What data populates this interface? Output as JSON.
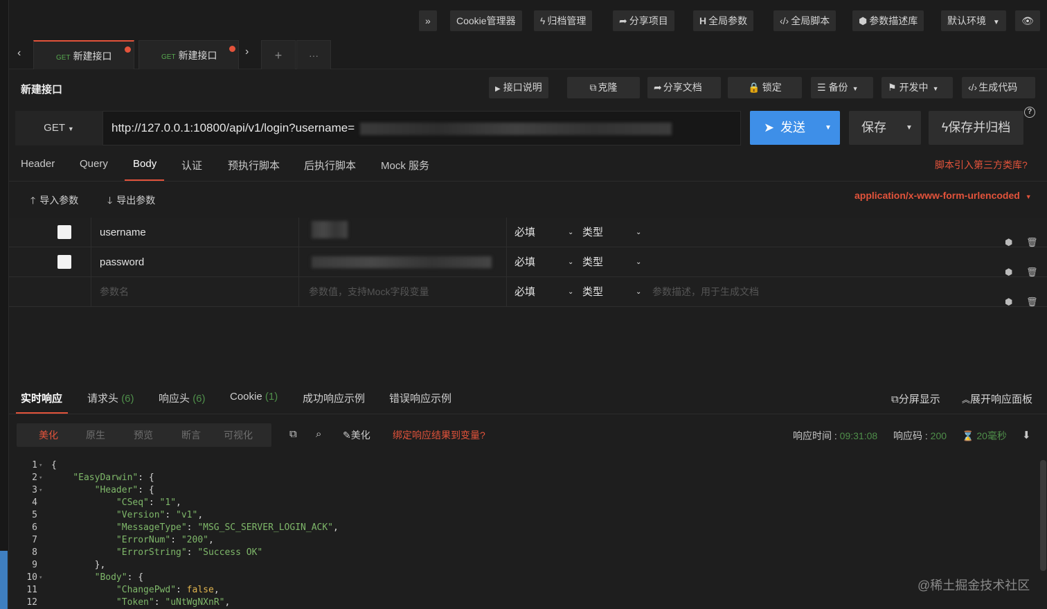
{
  "toolbar": {
    "expand": "»",
    "cookie_manager": "Cookie管理器",
    "archive_manage": "归档管理",
    "share_project": "分享项目",
    "global_params": "全局参数",
    "global_script": "全局脚本",
    "param_desc_lib": "参数描述库",
    "default_env": "默认环境"
  },
  "tabs": [
    {
      "method": "GET",
      "label": "新建接口"
    },
    {
      "method": "GET",
      "label": "新建接口"
    }
  ],
  "tabs_add": "+",
  "tabs_more": "···",
  "api": {
    "title": "新建接口",
    "doc_label": "接口说明",
    "clone_label": "克隆",
    "share_doc_label": "分享文档",
    "lock_label": "锁定",
    "backup_label": "备份",
    "status_label": "开发中",
    "gen_code_label": "生成代码"
  },
  "request": {
    "method": "GET",
    "url": "http://127.0.0.1:10800/api/v1/login?username=",
    "send_label": "发送",
    "save_label": "保存",
    "save_archive_label": "保存并归档",
    "help": "?"
  },
  "request_tabs": [
    "Header",
    "Query",
    "Body",
    "认证",
    "预执行脚本",
    "后执行脚本",
    "Mock 服务"
  ],
  "third_party_link": "脚本引入第三方类库?",
  "body": {
    "import_label": "导入参数",
    "export_label": "导出参数",
    "content_type": "application/x-www-form-urlencoded",
    "params": [
      {
        "name": "username",
        "required": "必填",
        "type": "类型"
      },
      {
        "name": "password",
        "required": "必填",
        "type": "类型"
      }
    ],
    "new_row": {
      "name_placeholder": "参数名",
      "value_placeholder": "参数值，支持Mock字段变量",
      "required": "必填",
      "type": "类型",
      "desc_placeholder": "参数描述，用于生成文档"
    }
  },
  "response": {
    "tabs": [
      {
        "label": "实时响应",
        "count": ""
      },
      {
        "label": "请求头",
        "count": "(6)"
      },
      {
        "label": "响应头",
        "count": "(6)"
      },
      {
        "label": "Cookie",
        "count": "(1)"
      },
      {
        "label": "成功响应示例",
        "count": ""
      },
      {
        "label": "错误响应示例",
        "count": ""
      }
    ],
    "split_view": "分屏显示",
    "expand_panel": "展开响应面板",
    "views": [
      "美化",
      "原生",
      "预览",
      "断言",
      "可视化"
    ],
    "beautify": "美化",
    "bind_var": "绑定响应结果到变量?",
    "time_label": "响应时间",
    "time_value": "09:31:08",
    "code_label": "响应码",
    "code_value": "200",
    "duration_value": "20毫秒"
  },
  "code_lines": [
    {
      "n": "1",
      "fold": true
    },
    {
      "n": "2",
      "fold": true
    },
    {
      "n": "3",
      "fold": true
    },
    {
      "n": "4",
      "fold": false
    },
    {
      "n": "5",
      "fold": false
    },
    {
      "n": "6",
      "fold": false
    },
    {
      "n": "7",
      "fold": false
    },
    {
      "n": "8",
      "fold": false
    },
    {
      "n": "9",
      "fold": false
    },
    {
      "n": "10",
      "fold": true
    },
    {
      "n": "11",
      "fold": false
    },
    {
      "n": "12",
      "fold": false
    }
  ],
  "code_text": {
    "l1": "{",
    "k_easydarwin": "\"EasyDarwin\"",
    "k_header": "\"Header\"",
    "k_cseq": "\"CSeq\"",
    "v_cseq": "\"1\"",
    "k_version": "\"Version\"",
    "v_version": "\"v1\"",
    "k_msgtype": "\"MessageType\"",
    "v_msgtype": "\"MSG_SC_SERVER_LOGIN_ACK\"",
    "k_errnum": "\"ErrorNum\"",
    "v_errnum": "\"200\"",
    "k_errstr": "\"ErrorString\"",
    "v_errstr": "\"Success OK\"",
    "l9": "},",
    "k_body": "\"Body\"",
    "k_changepwd": "\"ChangePwd\"",
    "v_changepwd": "false",
    "k_token": "\"Token\"",
    "v_token": "\"uNtWgNXnR\""
  },
  "watermark": "@稀土掘金技术社区",
  "colors": {
    "accent": "#e3533b",
    "primary": "#3e8fe8",
    "success": "#4f8f4a"
  }
}
